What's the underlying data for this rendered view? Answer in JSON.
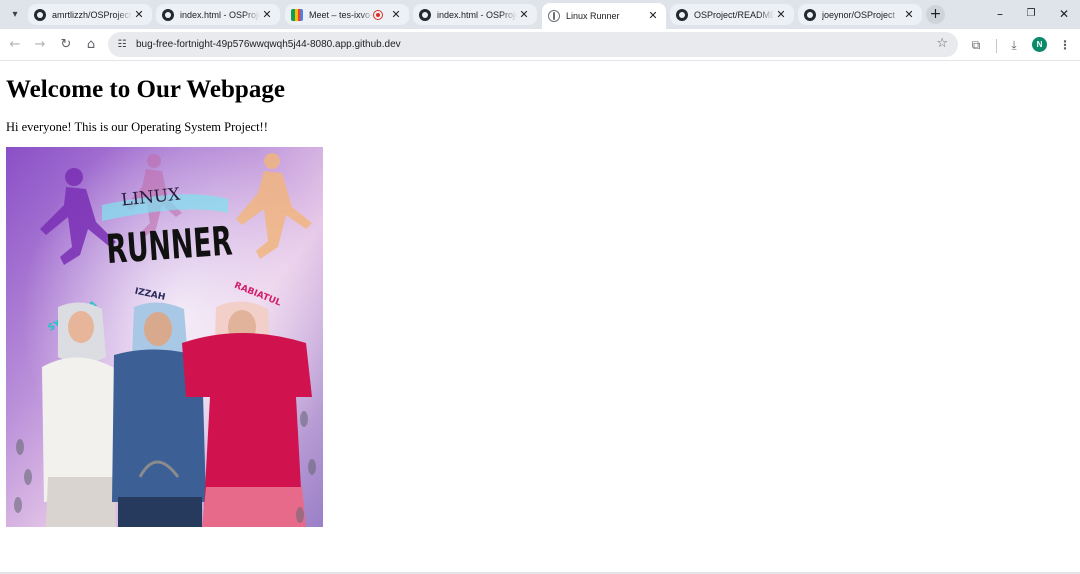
{
  "browser": {
    "tabs": [
      {
        "title": "amrtlizzh/OSProject",
        "favicon": "github-icon",
        "active": false
      },
      {
        "title": "index.html - OSProje",
        "favicon": "github-icon",
        "active": false
      },
      {
        "title": "Meet – tes-ixvo-",
        "favicon": "meet-icon",
        "active": false,
        "recording": true
      },
      {
        "title": "index.html - OSProje",
        "favicon": "github-icon",
        "active": false
      },
      {
        "title": "Linux Runner",
        "favicon": "globe-icon",
        "active": true
      },
      {
        "title": "OSProject/README.",
        "favicon": "github-icon",
        "active": false
      },
      {
        "title": "joeynor/OSProject",
        "favicon": "github-icon",
        "active": false
      }
    ],
    "address_bar": {
      "url": "bug-free-fortnight-49p576wwqwqh5j44-8080.app.github.dev"
    },
    "profile_initial": "N"
  },
  "page": {
    "heading": "Welcome to Our Webpage",
    "intro": "Hi everyone! This is our Operating System Project!!",
    "poster": {
      "title_small": "LINUX",
      "title_big": "RUNNER",
      "names": [
        "SYAZWINA",
        "IZZAH",
        "RABIATUL"
      ]
    }
  },
  "colors": {
    "tabstrip_bg": "#dfe3ea",
    "active_tab_bg": "#ffffff",
    "omnibox_bg": "#e8eaed",
    "profile_green": "#0b8a6a",
    "record_red": "#d93025"
  }
}
